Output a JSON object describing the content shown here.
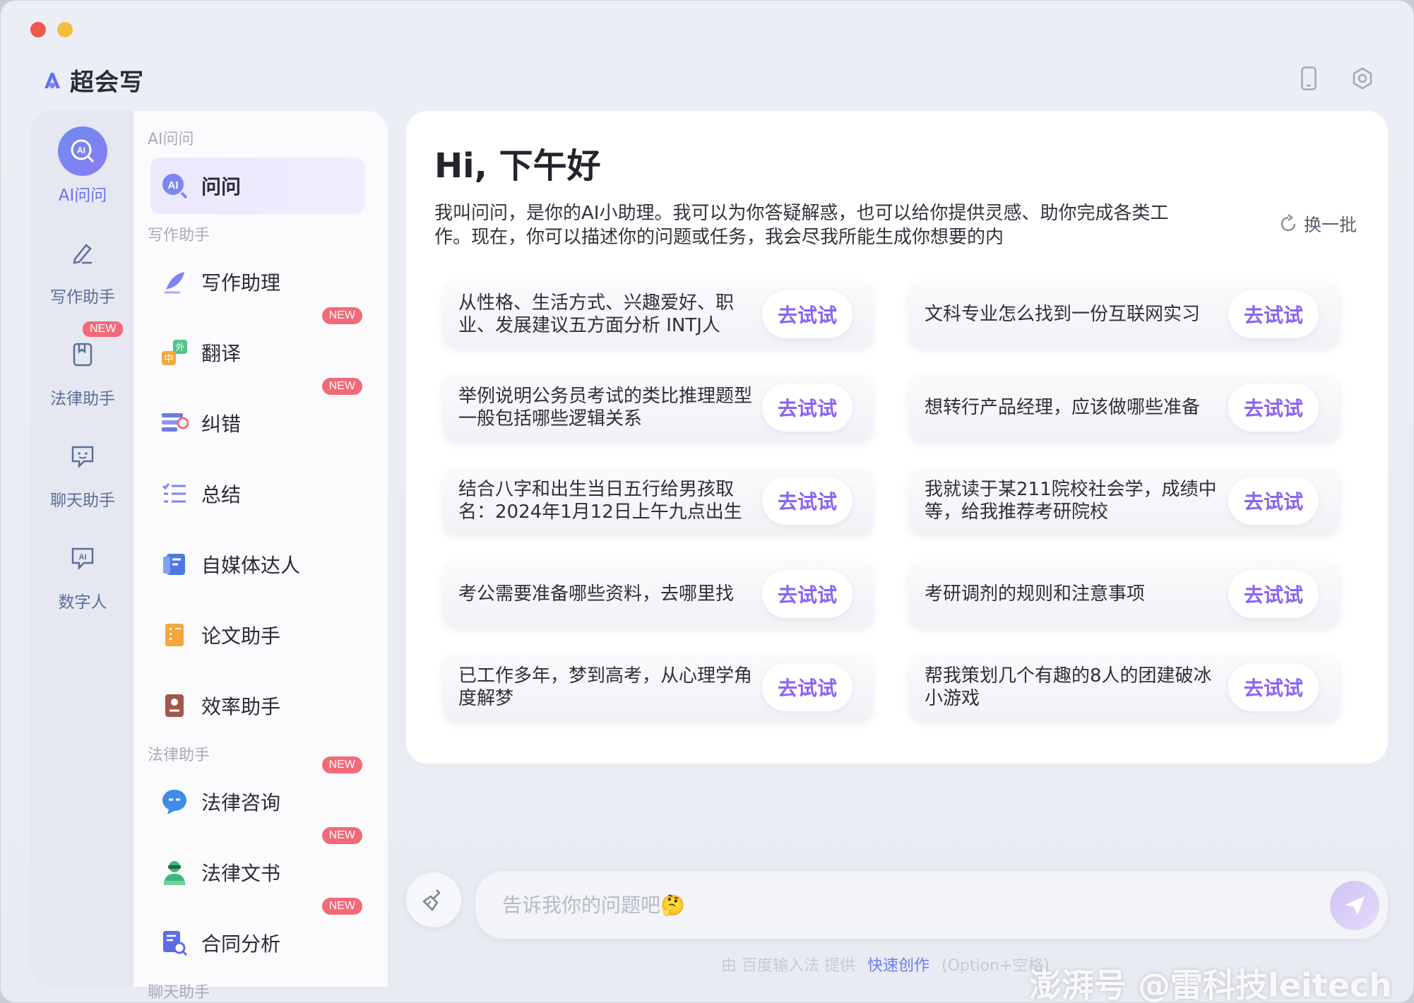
{
  "app": {
    "name": "超会写"
  },
  "rail": {
    "items": [
      {
        "label": "AI问问",
        "icon": "ai-chat-icon"
      },
      {
        "label": "写作助手",
        "icon": "pen-icon"
      },
      {
        "label": "法律助手",
        "icon": "book-icon",
        "badge": "NEW"
      },
      {
        "label": "聊天助手",
        "icon": "chat-bubble-icon"
      },
      {
        "label": "数字人",
        "icon": "ai-avatar-icon"
      }
    ]
  },
  "menu": {
    "sections": [
      "AI问问",
      "写作助手",
      "法律助手",
      "聊天助手"
    ],
    "items": [
      {
        "label": "问问"
      },
      {
        "label": "写作助理"
      },
      {
        "label": "翻译",
        "badge": "NEW"
      },
      {
        "label": "纠错",
        "badge": "NEW"
      },
      {
        "label": "总结"
      },
      {
        "label": "自媒体达人"
      },
      {
        "label": "论文助手"
      },
      {
        "label": "效率助手"
      },
      {
        "label": "法律咨询",
        "badge": "NEW"
      },
      {
        "label": "法律文书",
        "badge": "NEW"
      },
      {
        "label": "合同分析",
        "badge": "NEW"
      }
    ]
  },
  "main": {
    "greeting": "Hi, 下午好",
    "intro": "我叫问问，是你的AI小助理。我可以为你答疑解惑，也可以给你提供灵感、助你完成各类工作。现在，你可以描述你的问题或任务，我会尽我所能生成你想要的内",
    "refresh_label": "换一批",
    "try_label": "去试试",
    "questions": [
      "从性格、生活方式、兴趣爱好、职业、发展建议五方面分析 INTJ人",
      "文科专业怎么找到一份互联网实习",
      "举例说明公务员考试的类比推理题型一般包括哪些逻辑关系",
      "想转行产品经理，应该做哪些准备",
      "结合八字和出生当日五行给男孩取名：2024年1月12日上午九点出生",
      "我就读于某211院校社会学，成绩中等，给我推荐考研院校",
      "考公需要准备哪些资料，去哪里找",
      "考研调剂的规则和注意事项",
      "已工作多年，梦到高考，从心理学角度解梦",
      "帮我策划几个有趣的8人的团建破冰小游戏"
    ]
  },
  "input": {
    "placeholder": "告诉我你的问题吧🤔",
    "value": ""
  },
  "footer": {
    "provider": "由 百度输入法 提供",
    "link": "快速创作",
    "shortcut": "(Option+空格)"
  },
  "watermark": "澎湃号 @雷科技leitech",
  "colors": {
    "accent": "#8a64f2",
    "badge": "#f26a78",
    "rail_active": "#6a6ff0"
  }
}
